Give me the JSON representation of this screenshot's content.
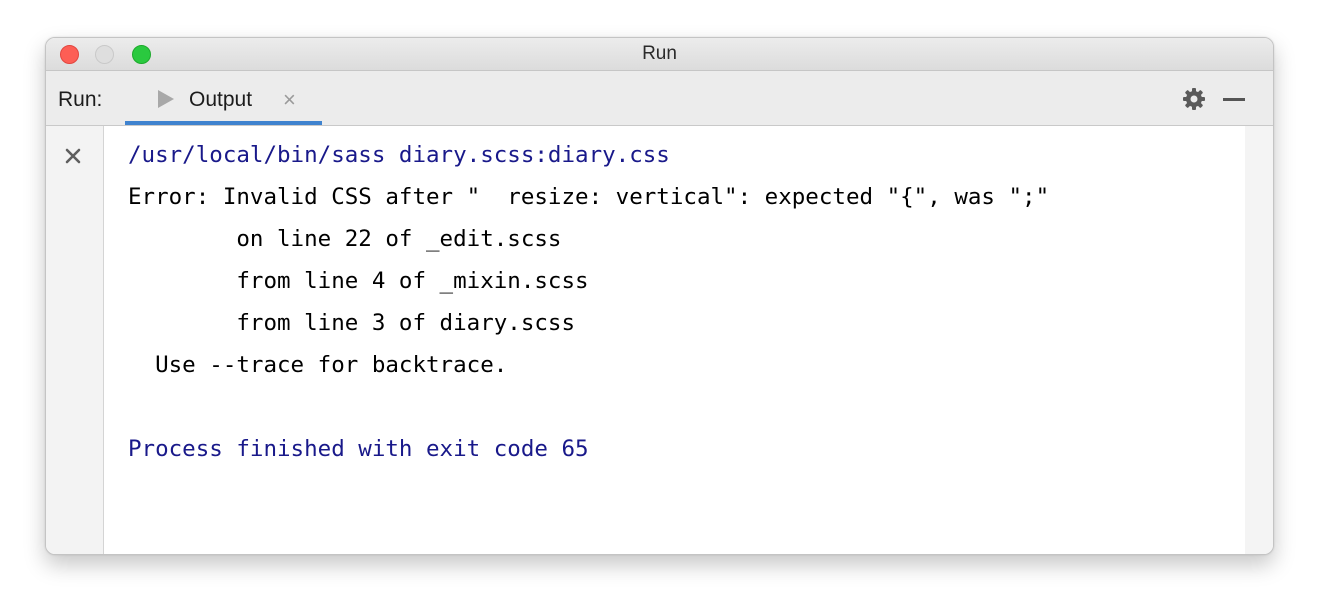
{
  "window": {
    "title": "Run"
  },
  "colors": {
    "accent": "#3f83cf",
    "command_text": "#19198a",
    "error_text": "#000000",
    "traffic_close": "#fd5e55",
    "traffic_minimize": "#dedede",
    "traffic_maximize": "#2ac93f"
  },
  "toolbar": {
    "run_label": "Run:",
    "tab": {
      "icon": "play-icon",
      "label": "Output",
      "close_glyph": "×"
    },
    "settings_icon": "gear-icon",
    "hide_icon": "minimize-icon"
  },
  "gutter": {
    "stop_icon": "close-icon"
  },
  "console": {
    "command": "/usr/local/bin/sass diary.scss:diary.css",
    "error_lines": [
      "Error: Invalid CSS after \"  resize: vertical\": expected \"{\", was \";\"",
      "        on line 22 of _edit.scss",
      "        from line 4 of _mixin.scss",
      "        from line 3 of diary.scss",
      "  Use --trace for backtrace."
    ],
    "exit_message": "Process finished with exit code 65"
  }
}
